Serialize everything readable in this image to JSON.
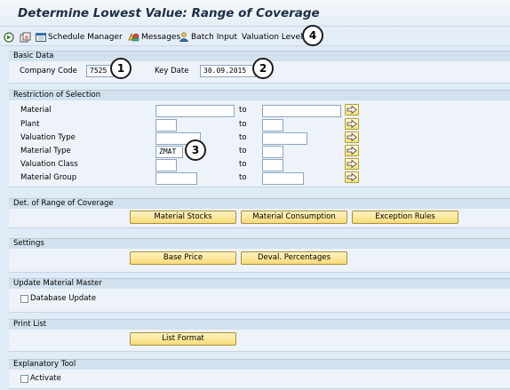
{
  "title": "Determine Lowest Value: Range of Coverage",
  "toolbar": {
    "schedule_manager": "Schedule Manager",
    "messages": "Messages",
    "batch_input": "Batch Input",
    "valuation_level": "Valuation Level"
  },
  "basic_data": {
    "header": "Basic Data",
    "company_code_label": "Company Code",
    "company_code_value": "7525",
    "key_date_label": "Key Date",
    "key_date_value": "30.09.2015"
  },
  "restriction": {
    "header": "Restriction of Selection",
    "to_label": "to",
    "rows": [
      {
        "label": "Material",
        "from": "",
        "to": ""
      },
      {
        "label": "Plant",
        "from": "",
        "to": ""
      },
      {
        "label": "Valuation Type",
        "from": "",
        "to": ""
      },
      {
        "label": "Material Type",
        "from": "ZMAT",
        "to": ""
      },
      {
        "label": "Valuation Class",
        "from": "",
        "to": ""
      },
      {
        "label": "Material Group",
        "from": "",
        "to": ""
      }
    ]
  },
  "coverage": {
    "header": "Det. of Range of Coverage",
    "material_stocks": "Material Stocks",
    "material_consumption": "Material Consumption",
    "exception_rules": "Exception Rules"
  },
  "settings": {
    "header": "Settings",
    "base_price": "Base Price",
    "deval_percentages": "Deval. Percentages"
  },
  "update_master": {
    "header": "Update Material Master",
    "database_update": "Database Update"
  },
  "print_list": {
    "header": "Print List",
    "list_format": "List Format"
  },
  "explanatory": {
    "header": "Explanatory Tool",
    "activate": "Activate"
  },
  "callouts": [
    "1",
    "2",
    "3",
    "4"
  ]
}
